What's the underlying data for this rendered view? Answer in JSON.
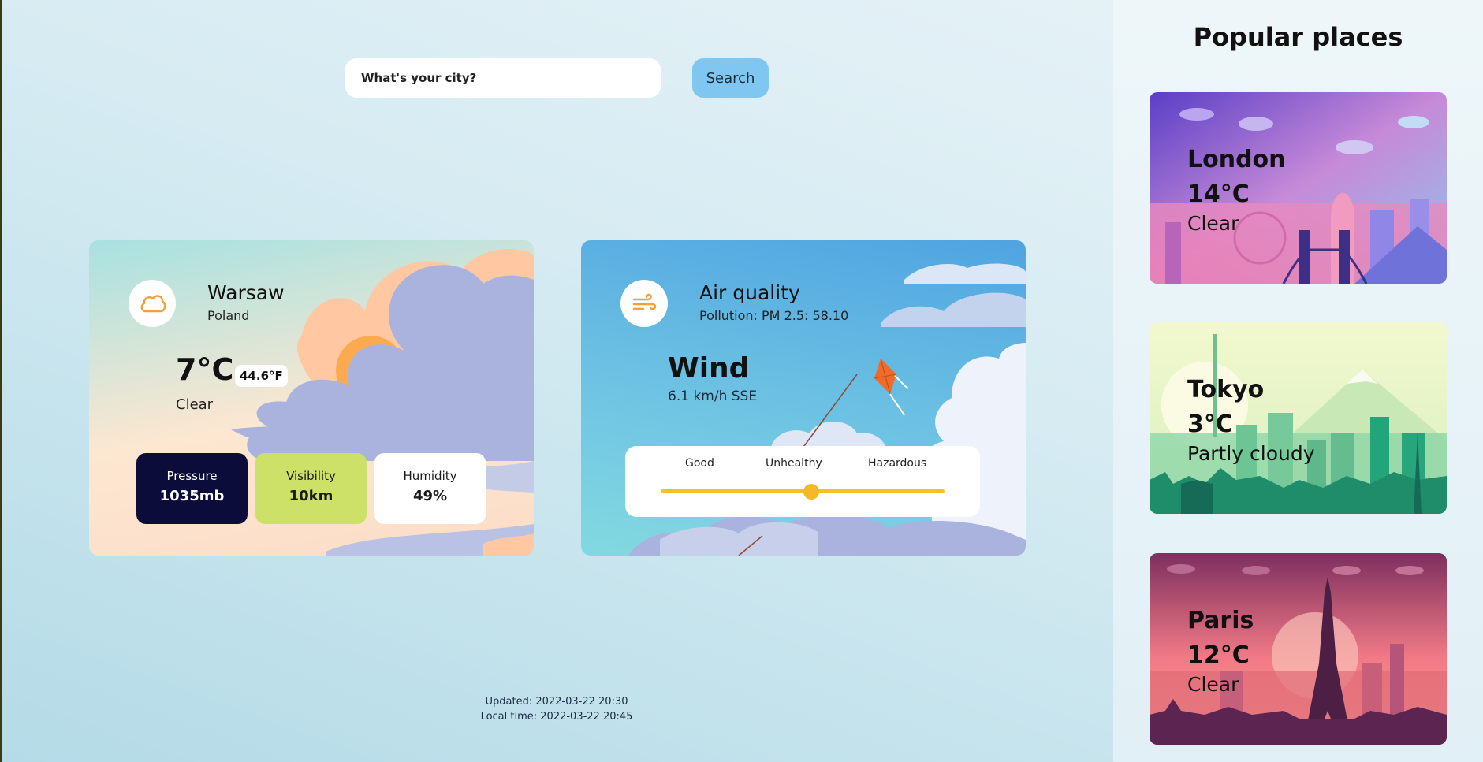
{
  "search": {
    "placeholder": "What's your city?",
    "button_label": "Search"
  },
  "weather": {
    "icon": "cloud-icon",
    "city": "Warsaw",
    "country": "Poland",
    "temp_c": "7°C",
    "temp_f": "44.6°F",
    "condition": "Clear",
    "stats": [
      {
        "label": "Pressure",
        "value": "1035mb"
      },
      {
        "label": "Visibility",
        "value": "10km"
      },
      {
        "label": "Humidity",
        "value": "49%"
      }
    ]
  },
  "air_quality": {
    "icon": "wind-icon",
    "title": "Air quality",
    "pollution": "Pollution: PM 2.5: 58.10",
    "wind_title": "Wind",
    "wind_value": "6.1 km/h SSE",
    "scale_labels": [
      "Good",
      "Unhealthy",
      "Hazardous"
    ],
    "level_fraction": 0.53
  },
  "footer": {
    "updated": "Updated: 2022-03-22 20:30",
    "local_time": "Local time: 2022-03-22 20:45"
  },
  "sidebar": {
    "title": "Popular places",
    "places": [
      {
        "name": "London",
        "temp": "14°C",
        "condition": "Clear"
      },
      {
        "name": "Tokyo",
        "temp": "3°C",
        "condition": "Partly cloudy"
      },
      {
        "name": "Paris",
        "temp": "12°C",
        "condition": "Clear"
      }
    ]
  },
  "colors": {
    "accent": "#f5b82a",
    "search_button": "#7fc7f0",
    "pressure_card": "#0c0c3a",
    "visibility_card": "#cde168",
    "humidity_card": "#ffffff",
    "weather_icon": "#f4a03a"
  }
}
